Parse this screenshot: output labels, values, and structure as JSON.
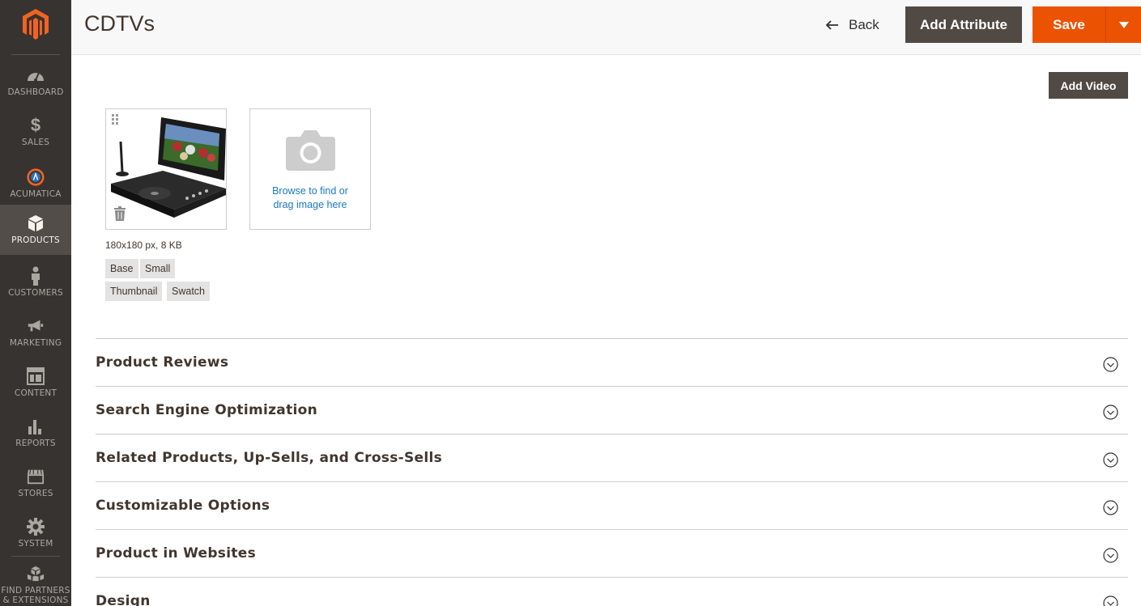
{
  "sidebar": {
    "logo": "magento-logo-icon",
    "items": [
      {
        "label": "DASHBOARD",
        "icon": "dashboard-icon",
        "active": false
      },
      {
        "label": "SALES",
        "icon": "dollar-icon",
        "active": false
      },
      {
        "label": "ACUMATICA",
        "icon": "acumatica-icon",
        "active": false
      },
      {
        "label": "PRODUCTS",
        "icon": "box-icon",
        "active": true
      },
      {
        "label": "CUSTOMERS",
        "icon": "person-icon",
        "active": false
      },
      {
        "label": "MARKETING",
        "icon": "megaphone-icon",
        "active": false
      },
      {
        "label": "CONTENT",
        "icon": "layout-icon",
        "active": false
      },
      {
        "label": "REPORTS",
        "icon": "bar-chart-icon",
        "active": false
      },
      {
        "label": "STORES",
        "icon": "storefront-icon",
        "active": false
      },
      {
        "label": "SYSTEM",
        "icon": "gear-icon",
        "active": false
      },
      {
        "label_line1": "FIND PARTNERS",
        "label_line2": "& EXTENSIONS",
        "icon": "cubes-icon",
        "active": false
      }
    ]
  },
  "header": {
    "title": "CDTVs",
    "back_label": "Back",
    "add_attribute_label": "Add Attribute",
    "save_label": "Save"
  },
  "media": {
    "add_video_label": "Add Video",
    "image_meta": "180x180 px, 8 KB",
    "roles": [
      "Base",
      "Small",
      "Thumbnail",
      "Swatch"
    ],
    "uploader_line1": "Browse to find or",
    "uploader_line2": "drag image here"
  },
  "sections": [
    {
      "title": "Product Reviews"
    },
    {
      "title": "Search Engine Optimization"
    },
    {
      "title": "Related Products, Up-Sells, and Cross-Sells"
    },
    {
      "title": "Customizable Options"
    },
    {
      "title": "Product in Websites"
    },
    {
      "title": "Design"
    }
  ],
  "colors": {
    "sidebar_bg": "#373330",
    "sidebar_active": "#524d49",
    "accent": "#eb5202",
    "dark_button": "#514943",
    "link": "#1979c3"
  }
}
